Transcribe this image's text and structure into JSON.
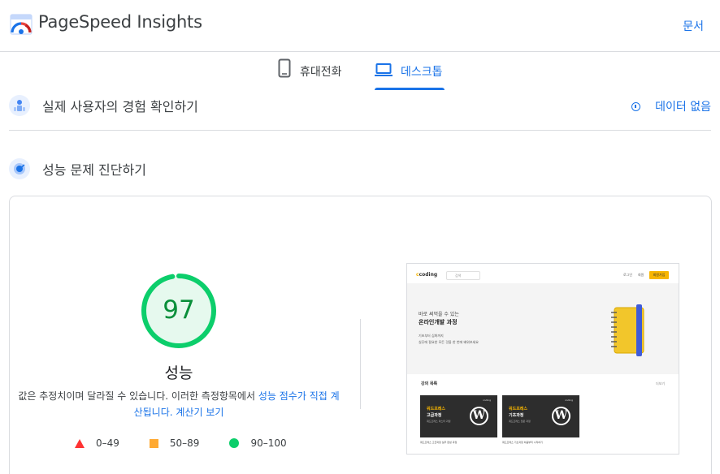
{
  "header": {
    "title": "PageSpeed Insights",
    "docs_link": "문서"
  },
  "tabs": [
    {
      "label": "휴대전화",
      "icon": "mobile-phone-icon",
      "active": false
    },
    {
      "label": "데스크톱",
      "icon": "laptop-icon",
      "active": true
    }
  ],
  "field_data": {
    "title": "실제 사용자의 경험 확인하기",
    "status": "데이터 없음",
    "icon": "users-icon"
  },
  "lab_data": {
    "title": "성능 문제 진단하기",
    "icon": "lighthouse-icon"
  },
  "score": {
    "value": "97",
    "fraction": 0.97,
    "label": "성능",
    "color": "#0cce6b",
    "description_plain": "값은 추정치이며 달라질 수 있습니다. 이러한 측정항목에서 ",
    "description_link1": "성능 점수가 직접 계산됩니다.",
    "description_link2": "계산기 보기"
  },
  "legend": [
    {
      "range": "0–49",
      "shape": "triangle",
      "color": "#ff3333"
    },
    {
      "range": "50–89",
      "shape": "square",
      "color": "#ffaa33"
    },
    {
      "range": "90–100",
      "shape": "circle",
      "color": "#0cce6b"
    }
  ],
  "screenshot": {
    "logo": "coding",
    "search_placeholder": "검색",
    "nav_login": "로그인",
    "nav_join": "회원",
    "nav_button": "회원가입",
    "hero_line1": "바로 써먹을 수 있는",
    "hero_line2": "온라인개발 과정",
    "hero_line3": "기초부터 심화까지",
    "hero_line4": "실무에 필요한 모든 것을 한 번에 배워보세요",
    "section_title": "강의 목록",
    "section_more": "더보기",
    "cards": [
      {
        "t1": "워드프레스",
        "t2": "고급과정",
        "t3": "워드프레스 마스터 과정",
        "brand": "coding",
        "caption": "워드프레스 고급과정 실무 완성 과정"
      },
      {
        "t1": "워드프레스",
        "t2": "기초과정",
        "t3": "워드프레스 입문 과정",
        "brand": "coding",
        "caption": "워드프레스 기초과정 처음부터 시작하기"
      }
    ]
  }
}
